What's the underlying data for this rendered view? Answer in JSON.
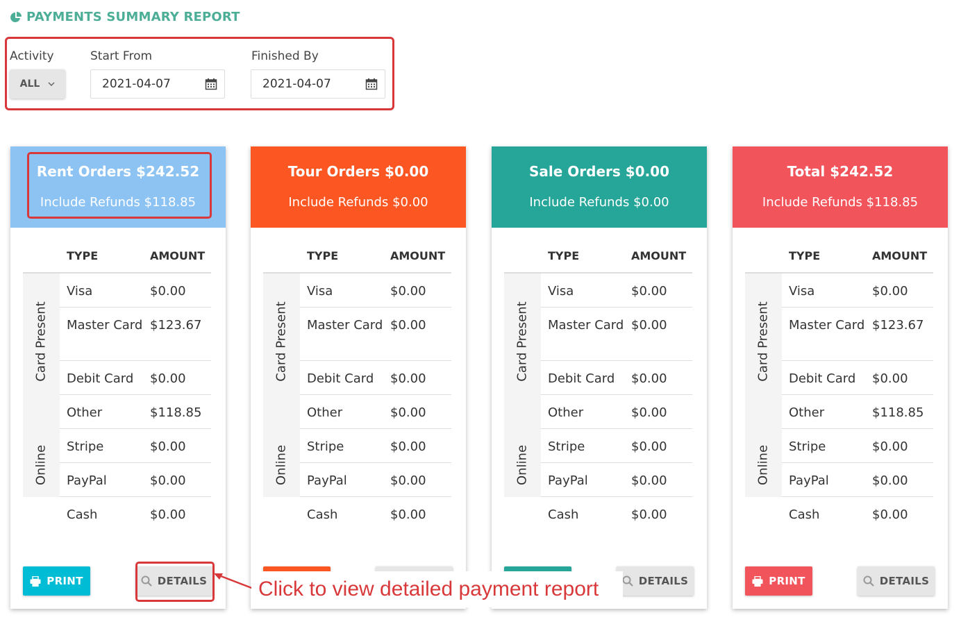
{
  "page": {
    "title": "PAYMENTS SUMMARY REPORT"
  },
  "filters": {
    "activity_label": "Activity",
    "activity_value": "ALL",
    "start_label": "Start From",
    "start_value": "2021-04-07",
    "finish_label": "Finished By",
    "finish_value": "2021-04-07"
  },
  "table_headers": {
    "type": "TYPE",
    "amount": "AMOUNT"
  },
  "groups": {
    "card_present": "Card Present",
    "online": "Online"
  },
  "buttons": {
    "print": "PRINT",
    "details": "DETAILS"
  },
  "cards": [
    {
      "title": "Rent Orders $242.52",
      "subtitle": "Include Refunds $118.85",
      "color": "#8cc3f3",
      "rows": [
        {
          "type": "Visa",
          "amount": "$0.00"
        },
        {
          "type": "Master Card",
          "amount": "$123.67"
        },
        {
          "type": "Debit Card",
          "amount": "$0.00"
        },
        {
          "type": "Other",
          "amount": "$118.85"
        },
        {
          "type": "Stripe",
          "amount": "$0.00"
        },
        {
          "type": "PayPal",
          "amount": "$0.00"
        },
        {
          "type": "Cash",
          "amount": "$0.00"
        }
      ]
    },
    {
      "title": "Tour Orders $0.00",
      "subtitle": "Include Refunds $0.00",
      "color": "#fc5722",
      "rows": [
        {
          "type": "Visa",
          "amount": "$0.00"
        },
        {
          "type": "Master Card",
          "amount": "$0.00"
        },
        {
          "type": "Debit Card",
          "amount": "$0.00"
        },
        {
          "type": "Other",
          "amount": "$0.00"
        },
        {
          "type": "Stripe",
          "amount": "$0.00"
        },
        {
          "type": "PayPal",
          "amount": "$0.00"
        },
        {
          "type": "Cash",
          "amount": "$0.00"
        }
      ]
    },
    {
      "title": "Sale Orders $0.00",
      "subtitle": "Include Refunds $0.00",
      "color": "#26a699",
      "rows": [
        {
          "type": "Visa",
          "amount": "$0.00"
        },
        {
          "type": "Master Card",
          "amount": "$0.00"
        },
        {
          "type": "Debit Card",
          "amount": "$0.00"
        },
        {
          "type": "Other",
          "amount": "$0.00"
        },
        {
          "type": "Stripe",
          "amount": "$0.00"
        },
        {
          "type": "PayPal",
          "amount": "$0.00"
        },
        {
          "type": "Cash",
          "amount": "$0.00"
        }
      ]
    },
    {
      "title": "Total $242.52",
      "subtitle": "Include Refunds $118.85",
      "color": "#f2545b",
      "rows": [
        {
          "type": "Visa",
          "amount": "$0.00"
        },
        {
          "type": "Master Card",
          "amount": "$123.67"
        },
        {
          "type": "Debit Card",
          "amount": "$0.00"
        },
        {
          "type": "Other",
          "amount": "$118.85"
        },
        {
          "type": "Stripe",
          "amount": "$0.00"
        },
        {
          "type": "PayPal",
          "amount": "$0.00"
        },
        {
          "type": "Cash",
          "amount": "$0.00"
        }
      ]
    }
  ],
  "print_button_colors": [
    "#00bcd4",
    "#fc5722",
    "#26a699",
    "#f2545b"
  ],
  "annotation": {
    "text": "Click to view detailed payment report",
    "color": "#d9383a"
  }
}
